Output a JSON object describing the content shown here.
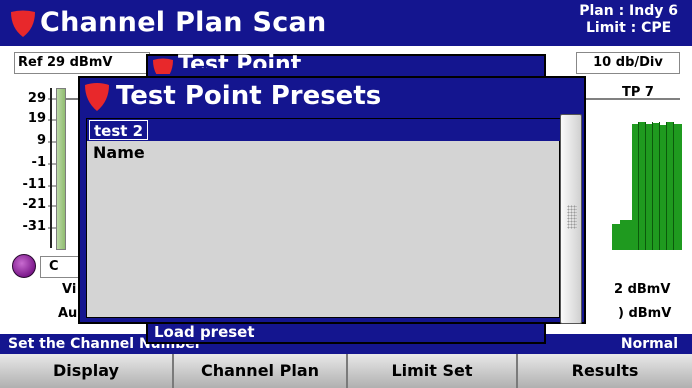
{
  "header": {
    "title": "Channel Plan Scan",
    "plan": "Plan : Indy 6",
    "limit": "Limit : CPE"
  },
  "graph": {
    "ref_level": "Ref 29 dBmV",
    "scale": "10 db/Div",
    "y_ticks": [
      "29",
      "19",
      "9",
      "-1",
      "-11",
      "-21",
      "-31"
    ],
    "marker_label": "TP 7",
    "channel_field": "C",
    "video_label": "Vi",
    "audio_label": "Au",
    "video_value": "2 dBmV",
    "audio_value": ") dBmV"
  },
  "background_dialog": {
    "title": "Test Point",
    "load_preset_label": "Load preset"
  },
  "dialog": {
    "title": "Test Point Presets",
    "items": [
      "test 2",
      "Name"
    ],
    "selected_index": 0
  },
  "status": {
    "hint": "Set the Channel Number",
    "mode": "Normal"
  },
  "softkeys": [
    "Display",
    "Channel Plan",
    "Limit Set",
    "Results"
  ],
  "colors": {
    "title_bar": "#14158f",
    "shield": "#e8282b",
    "list_bg": "#d4d4d4",
    "trace": "#1f9a1f"
  }
}
